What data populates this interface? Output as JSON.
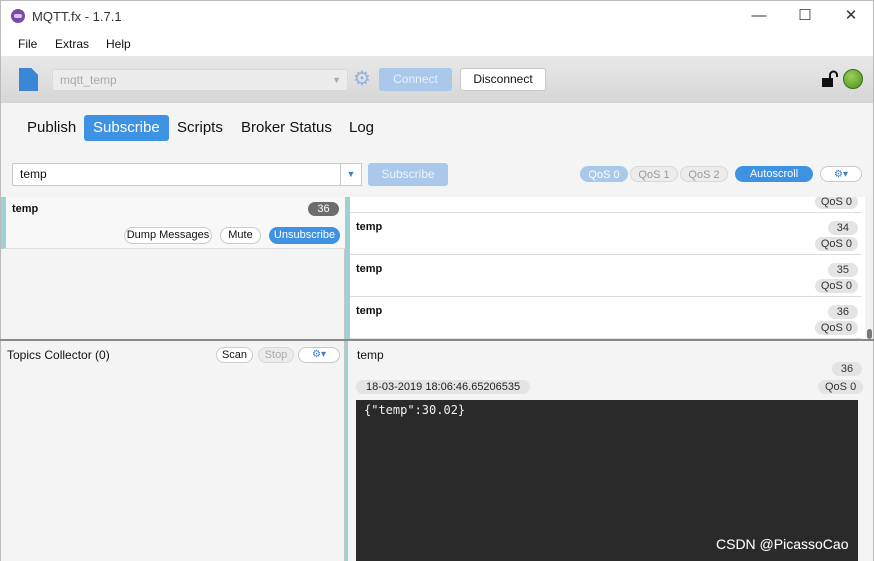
{
  "window": {
    "title": "MQTT.fx - 1.7.1",
    "minimize": "—",
    "maximize": "☐",
    "close": "✕"
  },
  "menu": [
    "File",
    "Extras",
    "Help"
  ],
  "connection": {
    "profile": "mqtt_temp",
    "connect_label": "Connect",
    "disconnect_label": "Disconnect",
    "status_color": "#5fa526"
  },
  "tabs": [
    {
      "label": "Publish",
      "active": false
    },
    {
      "label": "Subscribe",
      "active": true
    },
    {
      "label": "Scripts",
      "active": false
    },
    {
      "label": "Broker Status",
      "active": false
    },
    {
      "label": "Log",
      "active": false
    }
  ],
  "subscribe": {
    "topic_value": "temp",
    "subscribe_label": "Subscribe",
    "qos": [
      "QoS 0",
      "QoS 1",
      "QoS 2"
    ],
    "selected_qos": "QoS 0",
    "autoscroll_label": "Autoscroll"
  },
  "subscription": {
    "topic": "temp",
    "count": "36",
    "dump_label": "Dump Messages",
    "mute_label": "Mute",
    "unsubscribe_label": "Unsubscribe"
  },
  "messages": {
    "partial_qos": "QoS 0",
    "rows": [
      {
        "topic": "temp",
        "count": "34",
        "qos": "QoS 0"
      },
      {
        "topic": "temp",
        "count": "35",
        "qos": "QoS 0"
      },
      {
        "topic": "temp",
        "count": "36",
        "qos": "QoS 0"
      }
    ]
  },
  "collector": {
    "title": "Topics Collector (0)",
    "scan_label": "Scan",
    "stop_label": "Stop"
  },
  "detail": {
    "topic": "temp",
    "count": "36",
    "timestamp": "18-03-2019  18:06:46.65206535",
    "qos": "QoS 0",
    "payload": "{\"temp\":30.02}"
  },
  "watermark": "CSDN @PicassoCao"
}
